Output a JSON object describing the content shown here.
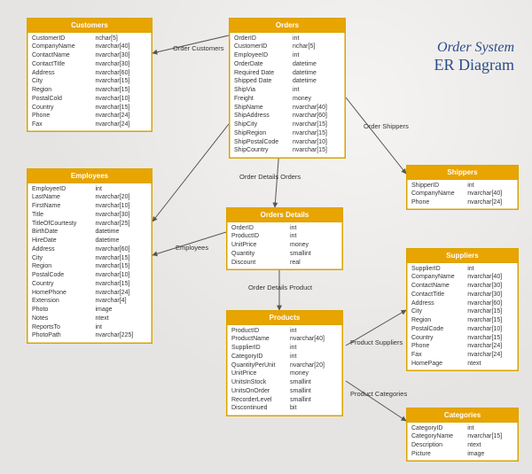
{
  "title": {
    "line1": "Order System",
    "line2": "ER Diagram"
  },
  "entities": {
    "customers": {
      "name": "Customers",
      "fields": [
        [
          "CustomerID",
          "nchar[5]"
        ],
        [
          "CompanyName",
          "nvarchar[40]"
        ],
        [
          "ContactName",
          "nvarchar[30]"
        ],
        [
          "ContactTitle",
          "nvarchar[30]"
        ],
        [
          "Address",
          "nvarchar[60]"
        ],
        [
          "City",
          "nvarchar[15]"
        ],
        [
          "Region",
          "nvarchar[15]"
        ],
        [
          "PostalCold",
          "nvarchar[10]"
        ],
        [
          "Country",
          "nvarchar[15]"
        ],
        [
          "Phone",
          "nvarchar[24]"
        ],
        [
          "Fax",
          "nvarchar[24]"
        ]
      ]
    },
    "orders": {
      "name": "Orders",
      "fields": [
        [
          "OrderID",
          "int"
        ],
        [
          "CustomerID",
          "nchar[5]"
        ],
        [
          "EmployeeID",
          "int"
        ],
        [
          "OrderDate",
          "datetime"
        ],
        [
          "Required Date",
          "datetime"
        ],
        [
          "Shipped Date",
          "datetime"
        ],
        [
          "ShipVia",
          "int"
        ],
        [
          "Freight",
          "money"
        ],
        [
          "ShipName",
          "nvarchar[40]"
        ],
        [
          "ShipAddress",
          "nvarchar[60]"
        ],
        [
          "ShipCity",
          "nvarchar[15]"
        ],
        [
          "ShipRegion",
          "nvarchar[15]"
        ],
        [
          "ShipPostalCode",
          "nvarchar[10]"
        ],
        [
          "ShipCountry",
          "nvarchar[15]"
        ]
      ]
    },
    "employees": {
      "name": "Employees",
      "fields": [
        [
          "EmployeeID",
          "int"
        ],
        [
          "LastName",
          "nvarchar[20]"
        ],
        [
          "FirstName",
          "nvarchar[10]"
        ],
        [
          "Title",
          "nvarchar[30]"
        ],
        [
          "TitleOfCourtesty",
          "nvarchar[25]"
        ],
        [
          "BirthDate",
          "datetime"
        ],
        [
          "HireDate",
          "datetime"
        ],
        [
          "Address",
          "nvarchar[60]"
        ],
        [
          "City",
          "nvarchar[15]"
        ],
        [
          "Region",
          "nvarchar[15]"
        ],
        [
          "PostalCode",
          "nvarchar[10]"
        ],
        [
          "Country",
          "nvarchar[15]"
        ],
        [
          "HomePhone",
          "nvarchar[24]"
        ],
        [
          "Extension",
          "nvarchar[4]"
        ],
        [
          "Photo",
          "image"
        ],
        [
          "Notes",
          "ntext"
        ],
        [
          "ReportsTo",
          "int"
        ],
        [
          "PhotoPath",
          "nvarchar[225]"
        ]
      ]
    },
    "orderDetails": {
      "name": "Orders Details",
      "fields": [
        [
          "OrderID",
          "int"
        ],
        [
          "ProductID",
          "int"
        ],
        [
          "UnitPrice",
          "money"
        ],
        [
          "Quantity",
          "smallint"
        ],
        [
          "Discount",
          "real"
        ]
      ]
    },
    "shippers": {
      "name": "Shippers",
      "fields": [
        [
          "ShipperID",
          "int"
        ],
        [
          "CompanyName",
          "nvarchar[40]"
        ],
        [
          "Phone",
          "nvarchar[24]"
        ]
      ]
    },
    "products": {
      "name": "Products",
      "fields": [
        [
          "ProductID",
          "int"
        ],
        [
          "ProductName",
          "nvarchar[40]"
        ],
        [
          "SupplierID",
          "int"
        ],
        [
          "CategoryID",
          "int"
        ],
        [
          "QuantityPerUnit",
          "nvarchar[20]"
        ],
        [
          "UnitPrice",
          "money"
        ],
        [
          "UnitsInStock",
          "smallint"
        ],
        [
          "UnitsOnOrder",
          "smallint"
        ],
        [
          "RecorderLevel",
          "smallint"
        ],
        [
          "Discontinued",
          "bit"
        ]
      ]
    },
    "suppliers": {
      "name": "Suppliers",
      "fields": [
        [
          "SupplierID",
          "int"
        ],
        [
          "CompanyName",
          "nvarchar[40]"
        ],
        [
          "ContactName",
          "nvarchar[30]"
        ],
        [
          "ContactTitle",
          "nvarchar[30]"
        ],
        [
          "Address",
          "nvarchar[60]"
        ],
        [
          "City",
          "nvarchar[15]"
        ],
        [
          "Region",
          "nvarchar[15]"
        ],
        [
          "PostalCode",
          "nvarchar[10]"
        ],
        [
          "Country",
          "nvarchar[15]"
        ],
        [
          "Phone",
          "nvarchar[24]"
        ],
        [
          "Fax",
          "nvarchar[24]"
        ],
        [
          "HomePage",
          "ntext"
        ]
      ]
    },
    "categories": {
      "name": "Categories",
      "fields": [
        [
          "CategoryID",
          "int"
        ],
        [
          "CategoryName",
          "nvarchar[15]"
        ],
        [
          "Description",
          "ntext"
        ],
        [
          "Picture",
          "image"
        ]
      ]
    }
  },
  "relationships": {
    "orderCustomers": "Order Customers",
    "orderShippers": "Order Shippers",
    "orderDetailsOrders": "Order Details Orders",
    "employees": "Employees",
    "orderDetailsProduct": "Order Details Product",
    "productSuppliers": "Product Suppliers",
    "productCategories": "Product Categories"
  }
}
